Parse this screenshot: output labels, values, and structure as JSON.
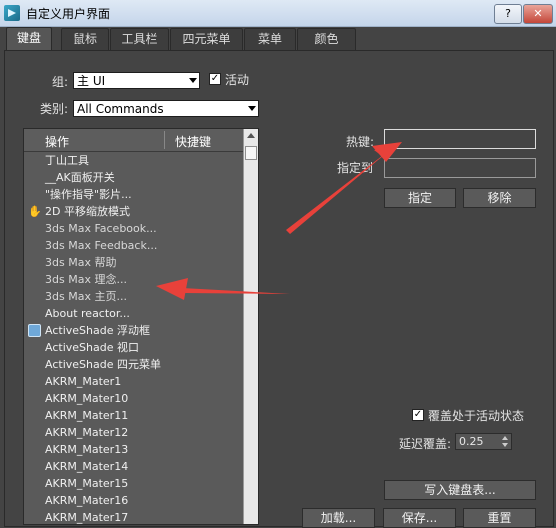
{
  "window": {
    "title": "自定义用户界面",
    "help": "?",
    "close": "✕"
  },
  "tabs": [
    "键盘",
    "鼠标",
    "工具栏",
    "四元菜单",
    "菜单",
    "颜色"
  ],
  "group": {
    "label": "组:",
    "value": "主 UI",
    "active_checkbox_label": "活动",
    "active_checked": true
  },
  "category": {
    "label": "类别:",
    "value": "All Commands"
  },
  "list": {
    "columns": [
      "操作",
      "快捷键"
    ],
    "rows": [
      {
        "text": "丁山工具",
        "icon": ""
      },
      {
        "text": "__AK面板开关",
        "icon": ""
      },
      {
        "text": "\"操作指导\"影片...",
        "icon": ""
      },
      {
        "text": "2D 平移缩放模式",
        "icon": "hand-icon"
      },
      {
        "text": "3ds Max Facebook...",
        "icon": ""
      },
      {
        "text": "3ds Max Feedback...",
        "icon": ""
      },
      {
        "text": "3ds Max 帮助",
        "icon": ""
      },
      {
        "text": "3ds Max 理念...",
        "icon": ""
      },
      {
        "text": "3ds Max 主页...",
        "icon": ""
      },
      {
        "text": "About reactor...",
        "icon": ""
      },
      {
        "text": "ActiveShade 浮动框",
        "icon": "activeshade-icon"
      },
      {
        "text": "ActiveShade 视口",
        "icon": ""
      },
      {
        "text": "ActiveShade 四元菜单",
        "icon": ""
      },
      {
        "text": "AKRM_Mater1",
        "icon": ""
      },
      {
        "text": "AKRM_Mater10",
        "icon": ""
      },
      {
        "text": "AKRM_Mater11",
        "icon": ""
      },
      {
        "text": "AKRM_Mater12",
        "icon": ""
      },
      {
        "text": "AKRM_Mater13",
        "icon": ""
      },
      {
        "text": "AKRM_Mater14",
        "icon": ""
      },
      {
        "text": "AKRM_Mater15",
        "icon": ""
      },
      {
        "text": "AKRM_Mater16",
        "icon": ""
      },
      {
        "text": "AKRM_Mater17",
        "icon": ""
      }
    ]
  },
  "hotkey": {
    "label": "热键:",
    "value": ""
  },
  "assigned_to": {
    "label": "指定到",
    "value": ""
  },
  "buttons": {
    "assign": "指定",
    "remove": "移除",
    "write_keyboard": "写入键盘表...",
    "load": "加载...",
    "save": "保存...",
    "reset": "重置"
  },
  "override": {
    "label": "覆盖处于活动状态",
    "checked": true
  },
  "delay": {
    "label": "延迟覆盖:",
    "value": "0.25"
  },
  "colors": {
    "panel": "#444444",
    "annotation_arrow": "#e8413a"
  }
}
